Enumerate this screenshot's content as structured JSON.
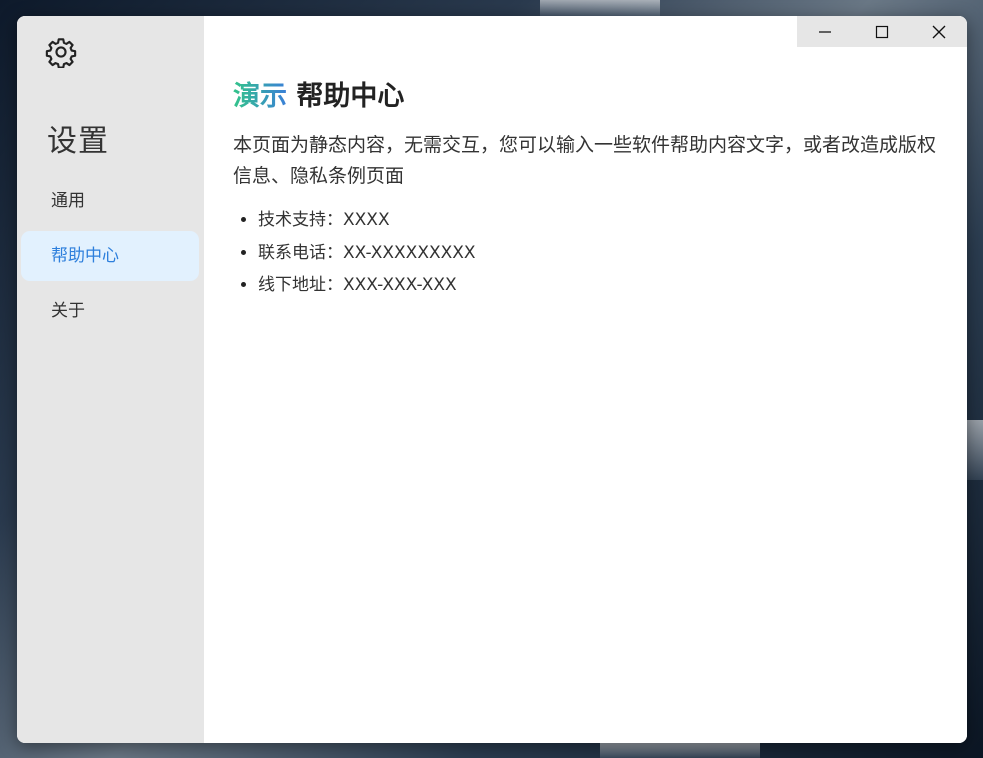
{
  "sidebar": {
    "icon": "gear-icon",
    "title": "设置",
    "items": [
      {
        "label": "通用",
        "active": false
      },
      {
        "label": "帮助中心",
        "active": true
      },
      {
        "label": "关于",
        "active": false
      }
    ]
  },
  "titlebar": {
    "buttons": [
      "minimize-icon",
      "maximize-icon",
      "close-icon"
    ]
  },
  "main": {
    "heading_accent": "演示",
    "heading_text": "帮助中心",
    "description": "本页面为静态内容，无需交互，您可以输入一些软件帮助内容文字，或者改造成版权信息、隐私条例页面",
    "list": [
      "技术支持：XXXX",
      "联系电话：XX-XXXXXXXXX",
      "线下地址：XXX-XXX-XXX"
    ]
  },
  "colors": {
    "sidebar_bg": "#e6e6e6",
    "active_item_bg": "#e2f1fe",
    "active_item_text": "#2d7fdc",
    "heading_gradient_start": "#33c48a",
    "heading_gradient_end": "#3a7fd8"
  }
}
